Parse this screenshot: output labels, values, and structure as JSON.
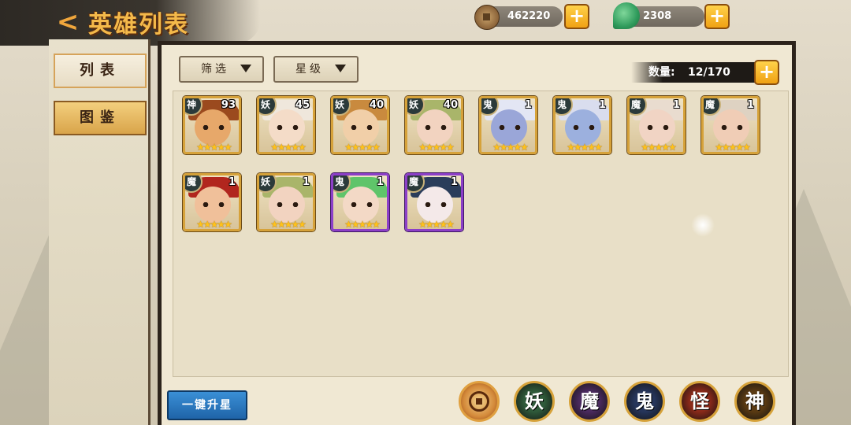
{
  "header": {
    "title": "英雄列表",
    "back_icon": "back-arrow-icon"
  },
  "resources": [
    {
      "name": "copper-coin",
      "icon": "coin-icon",
      "value": "462220"
    },
    {
      "name": "jade",
      "icon": "jade-icon",
      "value": "2308"
    }
  ],
  "sidebar": {
    "items": [
      {
        "label": "列表",
        "active": true
      },
      {
        "label": "图鉴",
        "active": false
      }
    ]
  },
  "toolbar": {
    "filter_label": "筛选",
    "star_label": "星级",
    "count_label": "数量:",
    "count_value": "12/170"
  },
  "heroes": [
    {
      "faction": "神",
      "level": "93",
      "stars": "★★★★★",
      "frame": "gold",
      "skin": "#e7a86a",
      "hair": "#9b4a1e"
    },
    {
      "faction": "妖",
      "level": "45",
      "stars": "★★★★★",
      "frame": "gold",
      "skin": "#f4dcc8",
      "hair": "#efe7dc"
    },
    {
      "faction": "妖",
      "level": "40",
      "stars": "★★★★★",
      "frame": "gold",
      "skin": "#f1cfa8",
      "hair": "#c98a3e"
    },
    {
      "faction": "妖",
      "level": "40",
      "stars": "★★★★★",
      "frame": "gold",
      "skin": "#f2d3c0",
      "hair": "#a9b56a"
    },
    {
      "faction": "鬼",
      "level": "1",
      "stars": "★★★★★",
      "frame": "gold",
      "skin": "#9aa6d8",
      "hair": "#e3e6f4"
    },
    {
      "faction": "鬼",
      "level": "1",
      "stars": "★★★★★",
      "frame": "gold",
      "skin": "#9cb0de",
      "hair": "#d9ddee"
    },
    {
      "faction": "魔",
      "level": "1",
      "stars": "★★★★★",
      "frame": "gold",
      "skin": "#f1d4c4",
      "hair": "#e9dccf"
    },
    {
      "faction": "魔",
      "level": "1",
      "stars": "★★★★★",
      "frame": "gold",
      "skin": "#f0cdb6",
      "hair": "#ded2c2"
    },
    {
      "faction": "魔",
      "level": "1",
      "stars": "★★★★★",
      "frame": "gold",
      "skin": "#f0c09a",
      "hair": "#b1261e"
    },
    {
      "faction": "妖",
      "level": "1",
      "stars": "★★★★★",
      "frame": "gold",
      "skin": "#f2d3c0",
      "hair": "#a9b56a"
    },
    {
      "faction": "鬼",
      "level": "1",
      "stars": "★★★★★",
      "frame": "purple",
      "skin": "#f3d9c6",
      "hair": "#5fc46a"
    },
    {
      "faction": "魔",
      "level": "1",
      "stars": "★★★★★",
      "frame": "purple",
      "skin": "#f4e9e9",
      "hair": "#2a3d5a"
    }
  ],
  "bottom": {
    "upstar_label": "一键升星",
    "filters": [
      {
        "label": "",
        "name": "all",
        "color": "#d48a3a"
      },
      {
        "label": "妖",
        "name": "yao",
        "color": "#2f5a3a"
      },
      {
        "label": "魔",
        "name": "mo",
        "color": "#4a2a5e"
      },
      {
        "label": "鬼",
        "name": "gui",
        "color": "#26355a"
      },
      {
        "label": "怪",
        "name": "guai",
        "color": "#8a2a1a"
      },
      {
        "label": "神",
        "name": "shen",
        "color": "#5a3a12"
      }
    ]
  }
}
